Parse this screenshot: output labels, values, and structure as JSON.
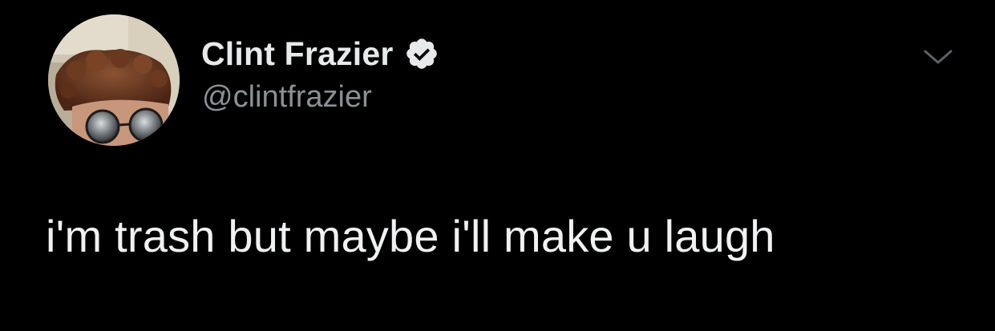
{
  "author": {
    "display_name": "Clint Frazier",
    "handle": "@clintfrazier",
    "verified": true,
    "avatar_icon": "profile-photo-icon",
    "verified_icon": "verified-badge-icon"
  },
  "tweet": {
    "text": "i'm trash but maybe i'll make u laugh"
  },
  "menu": {
    "icon": "chevron-down-icon"
  },
  "colors": {
    "background": "#000000",
    "name": "#e7e9ea",
    "handle": "#8b9096",
    "body_text": "#f0f1f2",
    "caret": "#5b6066",
    "badge": "#e7e9ea"
  }
}
